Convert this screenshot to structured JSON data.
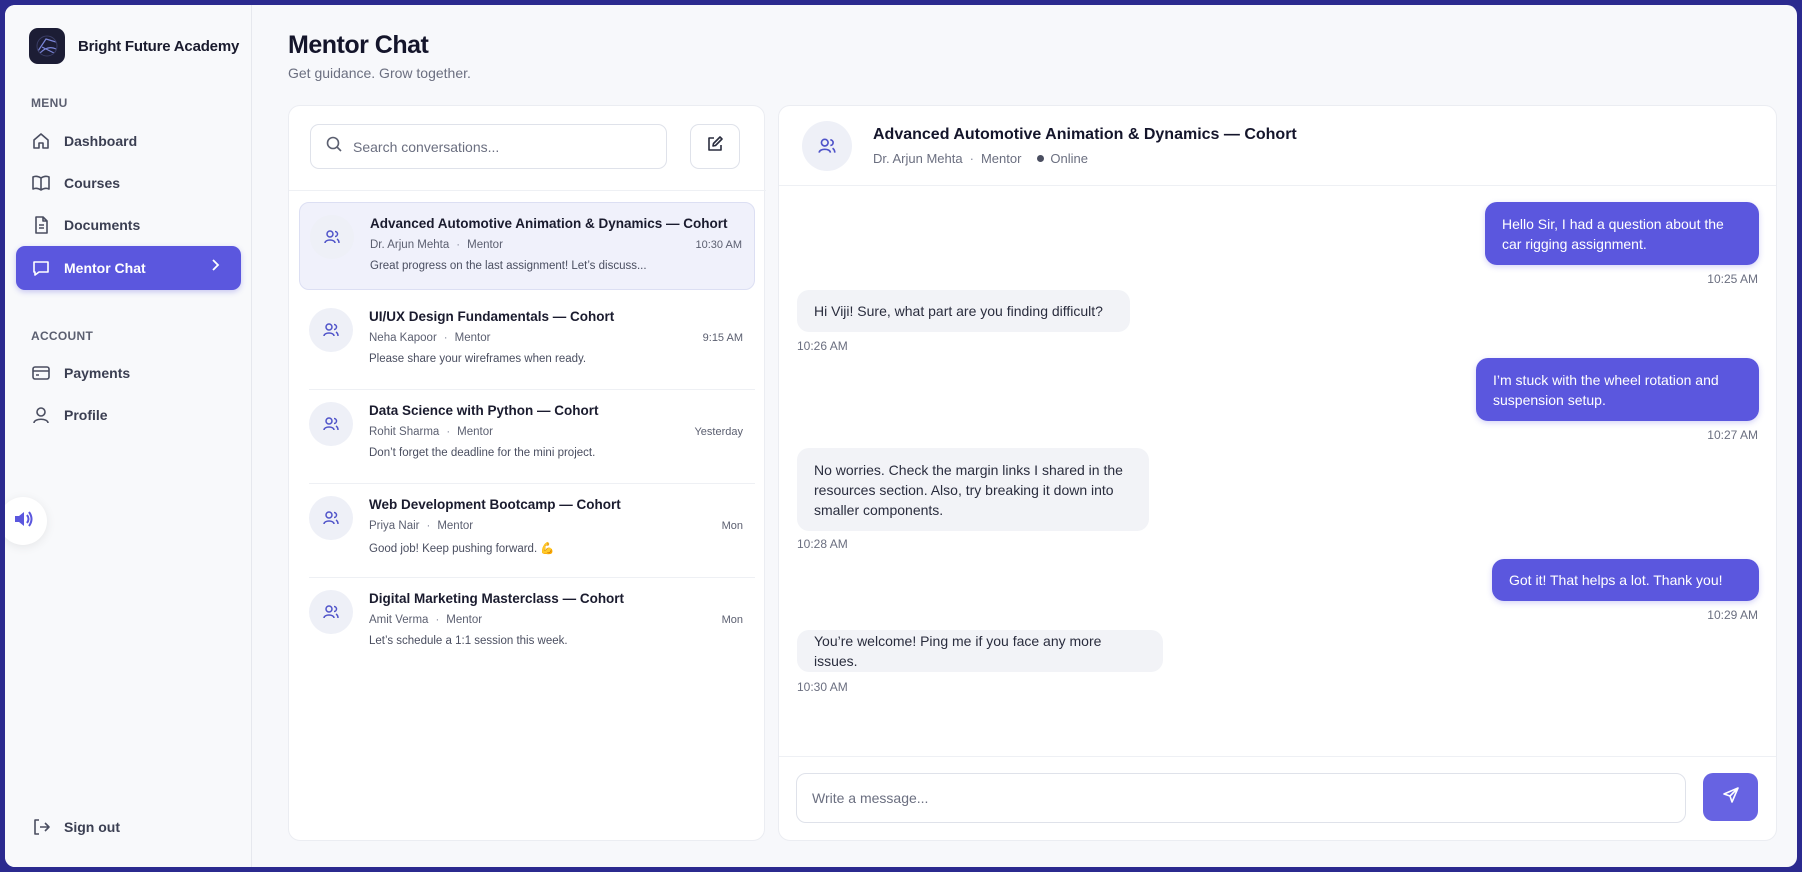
{
  "brand": {
    "name": "Bright Future Academy",
    "logo_icon": "compass-icon"
  },
  "sidebar": {
    "menu_label": "MENU",
    "menu_items": [
      {
        "label": "Dashboard",
        "icon": "home-icon"
      },
      {
        "label": "Courses",
        "icon": "book-icon"
      },
      {
        "label": "Documents",
        "icon": "document-icon"
      },
      {
        "label": "Mentor Chat",
        "icon": "chat-icon",
        "active": true
      }
    ],
    "account_label": "ACCOUNT",
    "account_items": [
      {
        "label": "Payments",
        "icon": "credit-card-icon"
      },
      {
        "label": "Profile",
        "icon": "user-icon"
      }
    ],
    "sign_out": "Sign out"
  },
  "header": {
    "title": "Mentor Chat",
    "subtitle": "Get guidance. Grow together."
  },
  "search": {
    "placeholder": "Search conversations..."
  },
  "conversations": [
    {
      "title": "Advanced Automotive Animation & Dynamics — Cohort",
      "mentor": "Dr. Arjun Mehta",
      "role": "Mentor",
      "time": "10:30 AM",
      "preview": "Great progress on the last assignment! Let’s discuss...",
      "selected": true
    },
    {
      "title": "UI/UX Design Fundamentals — Cohort",
      "mentor": "Neha Kapoor",
      "role": "Mentor",
      "time": "9:15 AM",
      "preview": "Please share your wireframes when ready."
    },
    {
      "title": "Data Science with Python — Cohort",
      "mentor": "Rohit Sharma",
      "role": "Mentor",
      "time": "Yesterday",
      "preview": "Don’t forget the deadline for the mini project."
    },
    {
      "title": "Web Development Bootcamp — Cohort",
      "mentor": "Priya Nair",
      "role": "Mentor",
      "time": "Mon",
      "preview": "Good job! Keep pushing forward. 💪"
    },
    {
      "title": "Digital Marketing Masterclass — Cohort",
      "mentor": "Amit Verma",
      "role": "Mentor",
      "time": "Mon",
      "preview": "Let’s schedule a 1:1 session this week."
    }
  ],
  "chat": {
    "title": "Advanced Automotive Animation & Dynamics — Cohort",
    "mentor": "Dr. Arjun Mehta",
    "role": "Mentor",
    "status": "Online",
    "messages": [
      {
        "from": "me",
        "text": "Hello Sir, I had a question about the car rigging assignment.",
        "time": "10:25 AM"
      },
      {
        "from": "mentor",
        "text": "Hi Viji! Sure, what part are you finding difficult?",
        "time": "10:26 AM"
      },
      {
        "from": "me",
        "text": "I’m stuck with the wheel rotation and suspension setup.",
        "time": "10:27 AM"
      },
      {
        "from": "mentor",
        "text": "No worries. Check the margin links I shared in the resources section. Also, try breaking it down into smaller components.",
        "time": "10:28 AM"
      },
      {
        "from": "me",
        "text": "Got it! That helps a lot. Thank you!",
        "time": "10:29 AM"
      },
      {
        "from": "mentor",
        "text": "You’re welcome! Ping me if you face any more issues.",
        "time": "10:30 AM"
      }
    ],
    "composer_placeholder": "Write a message..."
  },
  "colors": {
    "accent": "#5b57de",
    "frame": "#2b2a8f",
    "background": "#f7f8fb"
  }
}
